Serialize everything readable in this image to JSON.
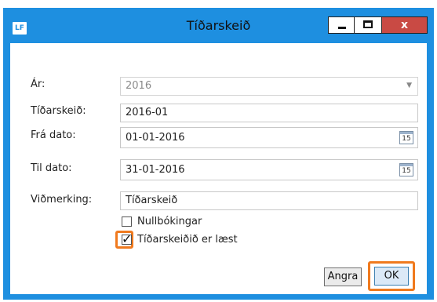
{
  "window": {
    "app_badge": "LF",
    "title": "Tíðarskeið",
    "controls": {
      "minimize": "minimize-icon",
      "maximize": "maximize-icon",
      "close_label": "x"
    }
  },
  "form": {
    "year": {
      "label": "Ár:",
      "value": "2016"
    },
    "period": {
      "label": "Tíðarskeið:",
      "value": "2016-01"
    },
    "from": {
      "label": "Frá dato:",
      "value": "01-01-2016",
      "calendar_day": "15"
    },
    "to": {
      "label": "Til dato:",
      "value": "31-01-2016",
      "calendar_day": "15"
    },
    "remark": {
      "label": "Viðmerking:",
      "value": "Tíðarskeið"
    }
  },
  "checkboxes": [
    {
      "label": "Nullbókingar",
      "checked": false
    },
    {
      "label": "Tíðarskeiðið er læst",
      "checked": true
    }
  ],
  "buttons": {
    "cancel": "Angra",
    "ok": "OK"
  },
  "colors": {
    "accent": "#1e8fe0",
    "highlight": "#f07a1e",
    "close": "#c94a44"
  }
}
